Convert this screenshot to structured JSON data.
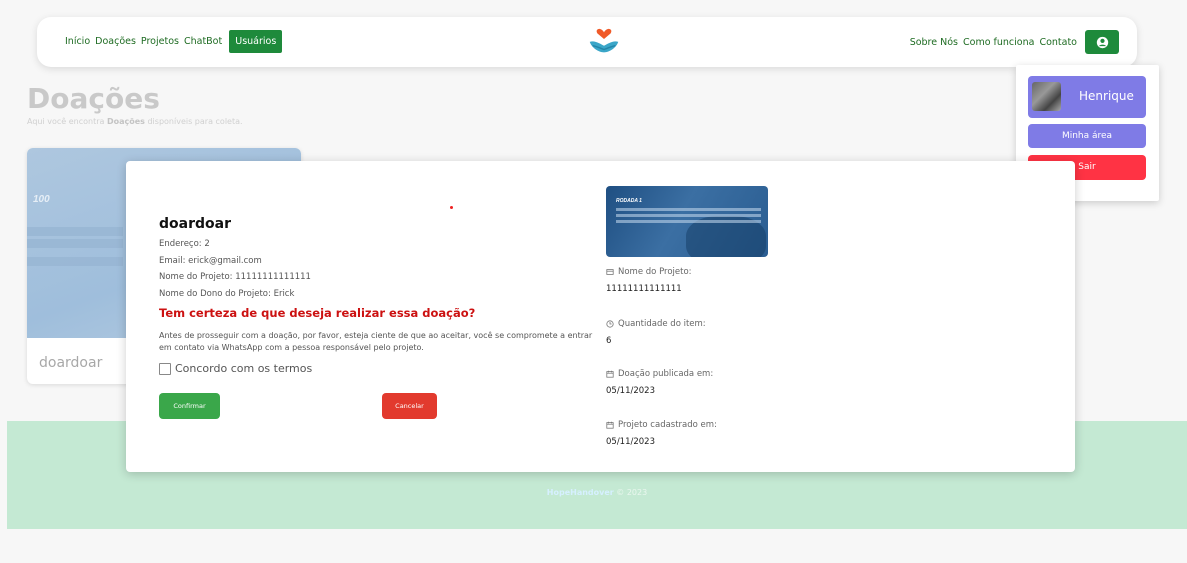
{
  "navbar": {
    "links_left": [
      "Início",
      "Doações",
      "Projetos",
      "ChatBot"
    ],
    "users_label": "Usuários",
    "links_right": [
      "Sobre Nós",
      "Como funciona",
      "Contato"
    ]
  },
  "page": {
    "title": "Doações",
    "subtitle_pre": "Aqui você encontra ",
    "subtitle_bold": "Doações",
    "subtitle_post": " disponíveis para coleta.",
    "card_title": "doardoar",
    "card_image_text": "100"
  },
  "footer": {
    "brand": "HopeHandover",
    "copyright": " © 2023"
  },
  "dropdown": {
    "user_name": "Henrique",
    "my_area_label": "Minha área",
    "logout_label": "Sair"
  },
  "modal": {
    "title": "doardoar",
    "address": "Endereço: 2",
    "email": "Email: erick@gmail.com",
    "project_name": "Nome do Projeto: 11111111111111",
    "project_owner": "Nome do Dono do Projeto: Erick",
    "question": "Tem certeza de que deseja realizar essa doação?",
    "description": "Antes de prosseguir com a doação, por favor, esteja ciente de que ao aceitar, você se compromete a entrar em contato via WhatsApp com a pessoa responsável pelo projeto.",
    "terms_label": "Concordo com os termos",
    "confirm_label": "Confirmar",
    "cancel_label": "Cancelar",
    "image_text": "RODADA 1",
    "details": {
      "project_name_label": "Nome do Projeto:",
      "project_name_value": "11111111111111",
      "quantity_label": "Quantidade do item:",
      "quantity_value": "6",
      "published_label": "Doação publicada em:",
      "published_value": "05/11/2023",
      "registered_label": "Projeto cadastrado em:",
      "registered_value": "05/11/2023"
    }
  },
  "colors": {
    "primary_green": "#1e8a3b",
    "accent_purple": "#7f7be6",
    "danger_red": "#ff3344",
    "question_red": "#cc1111"
  }
}
